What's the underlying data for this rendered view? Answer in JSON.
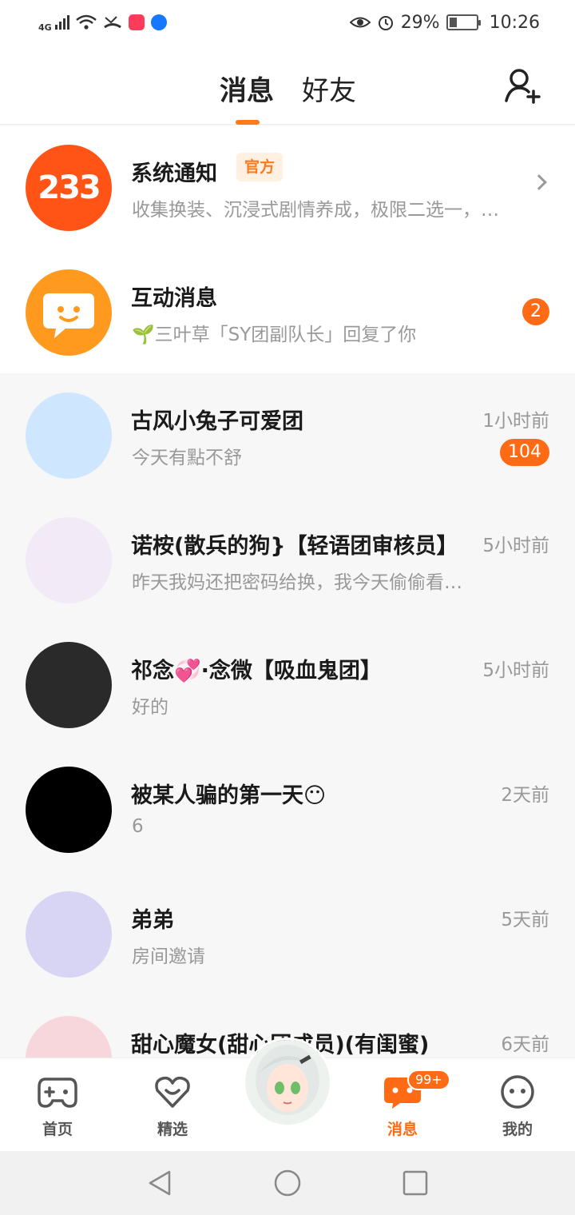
{
  "status_bar": {
    "network": "4G",
    "battery": "29%",
    "battery_level": 0.29,
    "time": "10:26"
  },
  "header": {
    "tabs": [
      {
        "label": "消息",
        "active": true
      },
      {
        "label": "好友",
        "active": false
      }
    ],
    "add_friend_icon": "add-user-icon"
  },
  "pinned": {
    "system": {
      "avatar_text": "233",
      "name": "系统通知",
      "tag": "官方",
      "preview": "收集换装、沉浸式剧情养成，极限二选一，…"
    },
    "interaction": {
      "name": "互动消息",
      "preview": "🌱三叶草「SY团副队长」回复了你",
      "badge": "2"
    }
  },
  "chats": [
    {
      "name": "古风小兔子可爱团",
      "preview": "今天有點不舒",
      "time": "1小时前",
      "badge": "104",
      "avatar_color": "#cfe6ff"
    },
    {
      "name": "诺桉(散兵的狗}【轻语团审核员】",
      "preview": "昨天我妈还把密码给换，我今天偷偷看…",
      "time": "5小时前",
      "avatar_color": "#f3eaf8"
    },
    {
      "name": "祁念💞·念微【吸血鬼团】",
      "preview": "好的",
      "time": "5小时前",
      "avatar_color": "#2a2a2a"
    },
    {
      "name": "被某人骗的第一天😶",
      "preview": "6",
      "time": "2天前",
      "avatar_color": "#000000"
    },
    {
      "name": "弟弟",
      "preview": "房间邀请",
      "time": "5天前",
      "avatar_color": "#d8d4f4"
    },
    {
      "name": "甜心魔女(甜心团成员)(有闺蜜)",
      "preview": "",
      "time": "6天前",
      "avatar_color": "#f7d6dc"
    }
  ],
  "bottom_nav": {
    "items": [
      {
        "label": "首页",
        "icon": "gamepad-icon",
        "active": false
      },
      {
        "label": "精选",
        "icon": "heart-icon",
        "active": false
      },
      {
        "label": "消息",
        "icon": "message-icon",
        "active": true,
        "badge": "99+"
      },
      {
        "label": "我的",
        "icon": "face-icon",
        "active": false
      }
    ]
  },
  "colors": {
    "accent": "#ff6a14"
  }
}
